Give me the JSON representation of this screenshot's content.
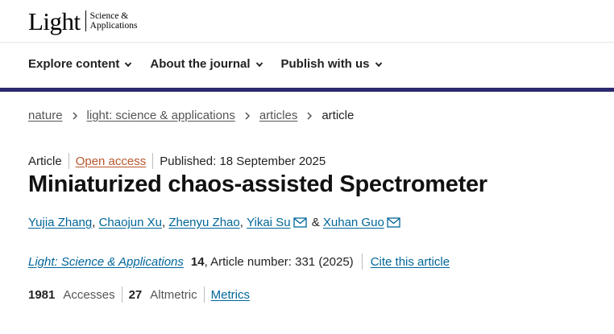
{
  "logo": {
    "main": "Light",
    "sub_line1": "Science &",
    "sub_line2": "Applications"
  },
  "nav": {
    "items": [
      {
        "label": "Explore content"
      },
      {
        "label": "About the journal"
      },
      {
        "label": "Publish with us"
      }
    ]
  },
  "breadcrumb": [
    "nature",
    "light: science & applications",
    "articles",
    "article"
  ],
  "meta": {
    "type": "Article",
    "access": "Open access",
    "published": "Published: 18 September 2025"
  },
  "title": "Miniaturized chaos-assisted Spectrometer",
  "authors": {
    "names": [
      "Yujia Zhang",
      "Chaojun Xu",
      "Zhenyu Zhao",
      "Yikai Su",
      "Xuhan Guo"
    ],
    "sep": ", ",
    "amp": " & "
  },
  "citation": {
    "journal": "Light: Science & Applications",
    "volume": "14",
    "article_number": ", Article number: 331 (2025)",
    "cite_label": "Cite this article"
  },
  "metrics": {
    "accesses_count": "1981",
    "accesses_label": "Accesses",
    "altmetric_count": "27",
    "altmetric_label": "Altmetric",
    "metrics_link": "Metrics"
  },
  "colors": {
    "nav_rule": "#2c2a6e",
    "link": "#006699",
    "open_access": "#b8562b"
  },
  "icons": {
    "nav_chevron": "chevron-down-icon",
    "breadcrumb_sep": "chevron-right-icon",
    "author_contact": "envelope-icon"
  }
}
